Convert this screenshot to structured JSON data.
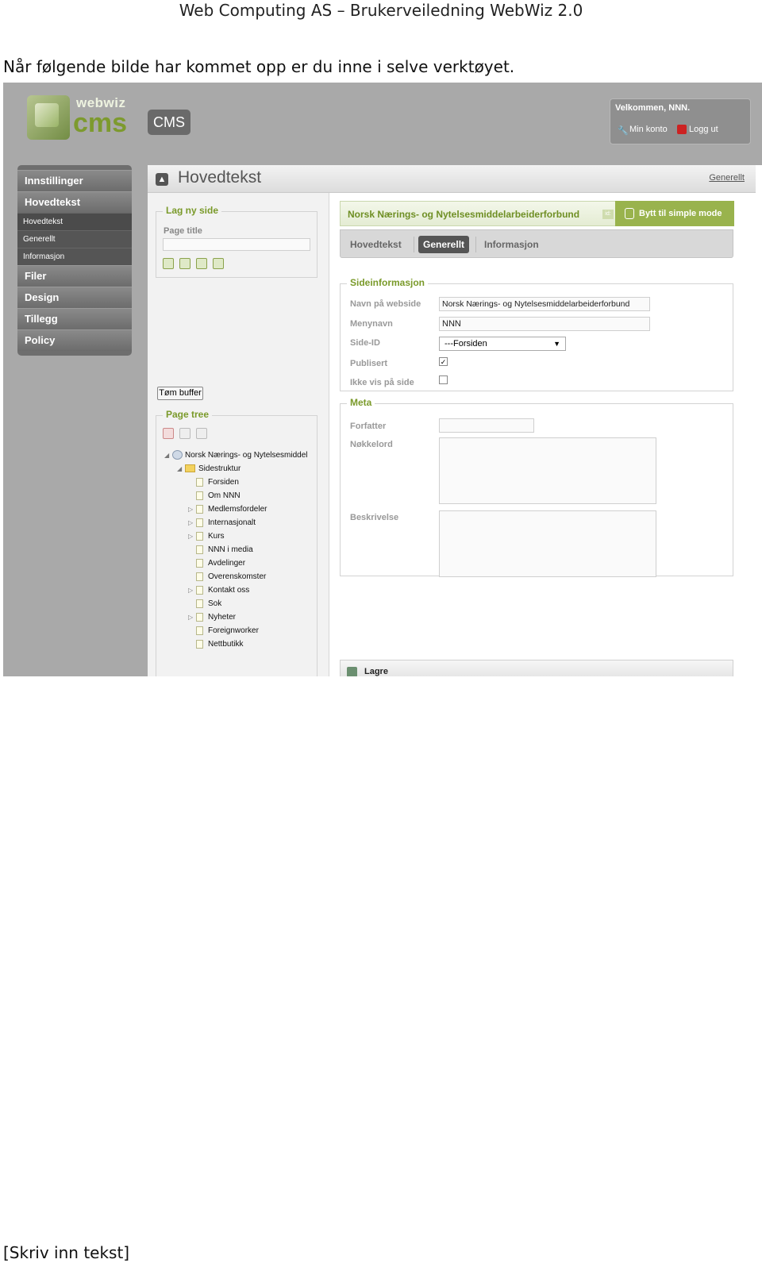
{
  "doc": {
    "header": "Web Computing AS – Brukerveiledning WebWiz 2.0",
    "intro": "Når følgende bilde har kommet opp er du inne i selve verktøyet.",
    "footer": "[Skriv inn tekst]"
  },
  "app": {
    "logo_text": "webwiz",
    "logo_cms": "cms",
    "badge": "CMS",
    "welcome": "Velkommen, NNN.",
    "my_account": "Min konto",
    "logout": "Logg ut"
  },
  "nav": {
    "items": [
      {
        "label": "Innstillinger",
        "type": "main"
      },
      {
        "label": "Hovedtekst",
        "type": "main"
      },
      {
        "label": "Hovedtekst",
        "type": "sub"
      },
      {
        "label": "Generellt",
        "type": "sub"
      },
      {
        "label": "Informasjon",
        "type": "sub"
      },
      {
        "label": "Filer",
        "type": "main"
      },
      {
        "label": "Design",
        "type": "main"
      },
      {
        "label": "Tillegg",
        "type": "main"
      },
      {
        "label": "Policy",
        "type": "main"
      }
    ]
  },
  "content": {
    "title": "Hovedtekst",
    "breadcrumb_link": "Generellt"
  },
  "side": {
    "new_page_legend": "Lag ny side",
    "page_title_label": "Page title",
    "page_title_value": "",
    "buffer_button": "Tøm buffer",
    "tree_legend": "Page tree",
    "tree": {
      "root": "Norsk Nærings- og Nytelsesmiddelarbeiderforbund",
      "root_visible": "Norsk Nærings- og Nytelsesmiddel",
      "folder": "Sidestruktur",
      "pages": [
        {
          "label": "Forsiden",
          "expandable": false
        },
        {
          "label": "Om NNN",
          "expandable": false
        },
        {
          "label": "Medlemsfordeler",
          "expandable": true
        },
        {
          "label": "Internasjonalt",
          "expandable": true
        },
        {
          "label": "Kurs",
          "expandable": true
        },
        {
          "label": "NNN i media",
          "expandable": false
        },
        {
          "label": "Avdelinger",
          "expandable": false
        },
        {
          "label": "Overenskomster",
          "expandable": false
        },
        {
          "label": "Kontakt oss",
          "expandable": true
        },
        {
          "label": "Sok",
          "expandable": false
        },
        {
          "label": "Nyheter",
          "expandable": true
        },
        {
          "label": "Foreignworker",
          "expandable": false
        },
        {
          "label": "Nettbutikk",
          "expandable": false
        }
      ]
    }
  },
  "main": {
    "site_title": "Norsk Nærings- og Nytelsesmiddelarbeiderforbund",
    "id_badge": "id:",
    "mode_button": "Bytt til simple mode",
    "tabs": [
      {
        "label": "Hovedtekst",
        "active": false
      },
      {
        "label": "Generellt",
        "active": true
      },
      {
        "label": "Informasjon",
        "active": false
      }
    ],
    "info_legend": "Sideinformasjon",
    "fields": {
      "website_name_label": "Navn på webside",
      "website_name_value": "Norsk Nærings- og Nytelsesmiddelarbeiderforbund",
      "menu_name_label": "Menynavn",
      "menu_name_value": "NNN",
      "side_id_label": "Side-ID",
      "side_id_value": "---Forsiden",
      "published_label": "Publisert",
      "published_checked": true,
      "hide_label": "Ikke vis på side",
      "hide_checked": false
    },
    "meta_legend": "Meta",
    "meta": {
      "author_label": "Forfatter",
      "author_value": "",
      "keywords_label": "Nøkkelord",
      "keywords_value": "",
      "description_label": "Beskrivelse",
      "description_value": ""
    },
    "save_label": "Lagre"
  },
  "colors": {
    "accent_green": "#7a9a2a",
    "mode_button": "#99b34d",
    "nav_background": "#6e6e6e",
    "app_background": "#a9a9a9"
  }
}
